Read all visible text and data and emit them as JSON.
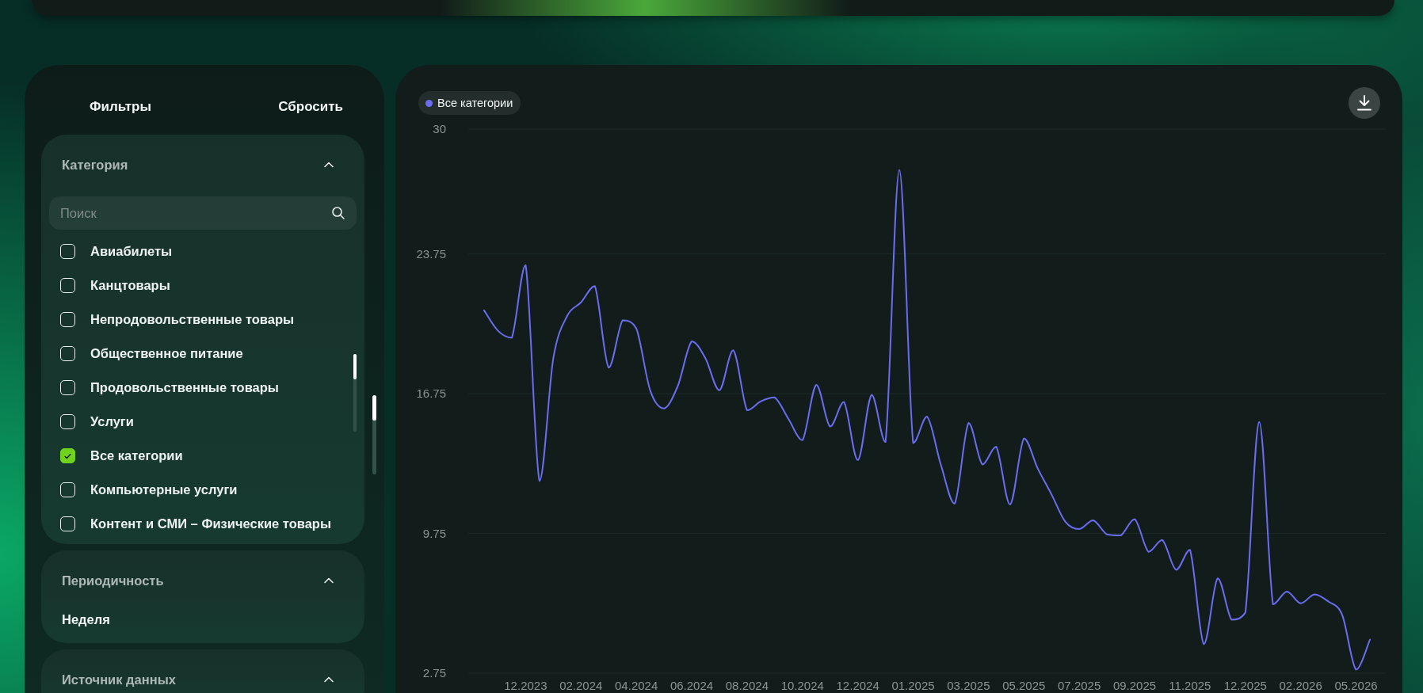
{
  "filters": {
    "title": "Фильтры",
    "reset": "Сбросить",
    "sections": [
      {
        "kind": "checklist",
        "title": "Категория",
        "expanded": true,
        "search": {
          "placeholder": "Поиск"
        },
        "items": [
          {
            "label": "Авиабилеты",
            "checked": false
          },
          {
            "label": "Канцтовары",
            "checked": false
          },
          {
            "label": "Непродовольственные товары",
            "checked": false
          },
          {
            "label": "Общественное питание",
            "checked": false
          },
          {
            "label": "Продовольственные товары",
            "checked": false
          },
          {
            "label": "Услуги",
            "checked": false
          },
          {
            "label": "Все категории",
            "checked": true
          },
          {
            "label": "Компьютерные услуги",
            "checked": false
          },
          {
            "label": "Контент и СМИ – Физические товары",
            "checked": false
          }
        ]
      },
      {
        "kind": "value",
        "title": "Периодичность",
        "expanded": true,
        "value": "Неделя"
      },
      {
        "kind": "value",
        "title": "Источник данных",
        "expanded": true
      }
    ]
  },
  "chart_panel": {
    "chart_data": {
      "type": "line",
      "categories": [
        null,
        null,
        null,
        "12.2023",
        null,
        null,
        null,
        "02.2024",
        null,
        null,
        null,
        "04.2024",
        null,
        null,
        null,
        "06.2024",
        null,
        null,
        null,
        "08.2024",
        null,
        null,
        null,
        "10.2024",
        null,
        null,
        null,
        "12.2024",
        null,
        null,
        null,
        "01.2025",
        null,
        null,
        null,
        "03.2025",
        null,
        null,
        null,
        "05.2025",
        null,
        null,
        null,
        "07.2025",
        null,
        null,
        null,
        "09.2025",
        null,
        null,
        null,
        "11.2025",
        null,
        null,
        null,
        "12.2025",
        null,
        null,
        null,
        "02.2026",
        null,
        null,
        null,
        "05.2026",
        null
      ],
      "series": [
        {
          "name": "Все категории",
          "color": "#6b6cf0",
          "values": [
            20.92,
            19.9,
            19.55,
            23.19,
            12.38,
            18.51,
            20.64,
            21.32,
            22.14,
            18.05,
            20.42,
            20.01,
            16.92,
            16.01,
            17.15,
            19.37,
            18.51,
            16.92,
            18.92,
            15.92,
            16.37,
            16.56,
            15.47,
            14.42,
            17.19,
            15.1,
            16.33,
            13.42,
            16.69,
            14.33,
            27.96,
            14.28,
            15.6,
            13.19,
            11.24,
            15.28,
            13.2,
            14.1,
            11.2,
            14.51,
            13.0,
            11.7,
            10.33,
            9.97,
            10.4,
            9.7,
            9.65,
            10.47,
            8.83,
            9.42,
            7.93,
            8.93,
            4.2,
            7.5,
            5.43,
            5.79,
            15.33,
            6.2,
            6.84,
            6.25,
            6.7,
            6.34,
            5.66,
            2.93,
            4.43
          ]
        }
      ],
      "ylim": [
        2.75,
        30
      ],
      "grid": true,
      "yticks": [
        2.75,
        9.75,
        16.75,
        23.75,
        30
      ]
    }
  }
}
